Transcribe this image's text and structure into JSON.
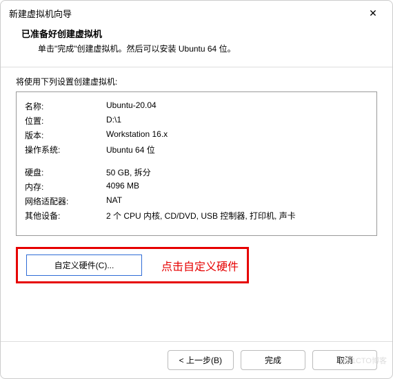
{
  "titlebar": {
    "text": "新建虚拟机向导",
    "close": "✕"
  },
  "header": {
    "title": "已准备好创建虚拟机",
    "desc": "单击\"完成\"创建虚拟机。然后可以安装 Ubuntu 64 位。"
  },
  "content": {
    "label": "将使用下列设置创建虚拟机:"
  },
  "settings": {
    "rows1": [
      {
        "label": "名称:",
        "value": "Ubuntu-20.04"
      },
      {
        "label": "位置:",
        "value": "D:\\1"
      },
      {
        "label": "版本:",
        "value": "Workstation 16.x"
      },
      {
        "label": "操作系统:",
        "value": "Ubuntu 64 位"
      }
    ],
    "rows2": [
      {
        "label": "硬盘:",
        "value": "50 GB, 拆分"
      },
      {
        "label": "内存:",
        "value": "4096 MB"
      },
      {
        "label": "网络适配器:",
        "value": "NAT"
      },
      {
        "label": "其他设备:",
        "value": "2 个 CPU 内核, CD/DVD, USB 控制器, 打印机, 声卡"
      }
    ]
  },
  "custom": {
    "button": "自定义硬件(C)...",
    "annotation": "点击自定义硬件"
  },
  "footer": {
    "back": "< 上一步(B)",
    "finish": "完成",
    "cancel": "取消"
  },
  "watermark": "@51CTO博客"
}
